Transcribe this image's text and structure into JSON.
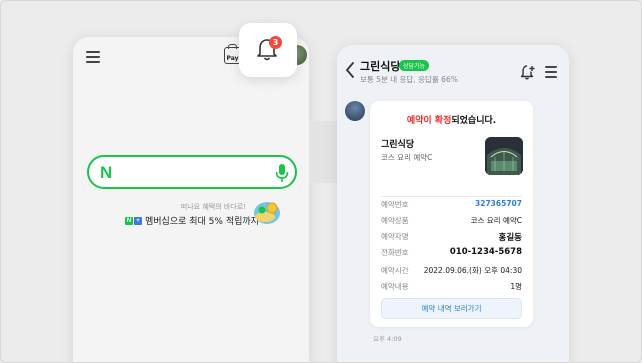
{
  "colors": {
    "naver_green": "#19c44a",
    "link_blue": "#2f7de1",
    "alert_red": "#e8302a",
    "badge_red": "#f04b3a"
  },
  "left_phone": {
    "menu_icon": "hamburger-icon",
    "pay_label": "Pay",
    "notification": {
      "icon": "bell-icon",
      "count": "3"
    },
    "search": {
      "logo": "N",
      "mic_icon": "microphone-icon"
    },
    "promo": {
      "small_text": "떠나요 혜택의 바다로!",
      "badge_n": "N",
      "badge_plus": "+",
      "main_text": "멤버십으로 최대 5% 적립까지"
    }
  },
  "right_phone": {
    "header": {
      "back_icon": "chevron-left-icon",
      "shop_name": "그린식당",
      "consult_badge": "상담가능",
      "response_info": "보통 5분 내 응답, 응답률 66%",
      "alarm_icon": "bell-plus-icon",
      "menu_icon": "hamburger-icon"
    },
    "card": {
      "title_highlight": "예약이 확정",
      "title_rest": "되었습니다.",
      "store_name": "그린식당",
      "course_name": "코스 요리 예약C",
      "rows": [
        {
          "key": "예약번호",
          "value": "327365707"
        },
        {
          "key": "예약상품",
          "value": "코스 요리 예약C"
        },
        {
          "key": "예약자명",
          "value": "홍길동"
        },
        {
          "key": "전화번호",
          "value": "010-1234-5678"
        },
        {
          "key": "예약시간",
          "value": "2022.09.06.(화) 오후 04:30"
        },
        {
          "key": "예약내용",
          "value": "1명"
        }
      ],
      "button_label": "예약 내역 보러가기"
    },
    "message_time": "오후 4:09"
  }
}
